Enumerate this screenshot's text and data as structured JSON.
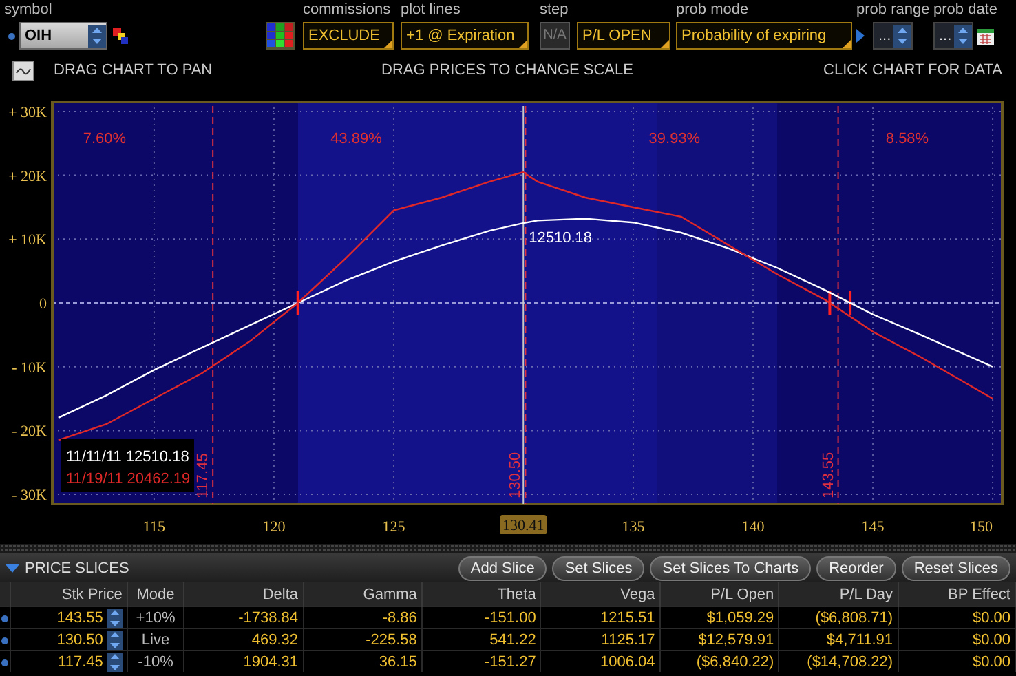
{
  "toolbar": {
    "symbol": {
      "label": "symbol",
      "value": "OIH"
    },
    "commissions": {
      "label": "commissions",
      "value": "EXCLUDE"
    },
    "plot_lines": {
      "label": "plot lines",
      "value": "+1 @ Expiration"
    },
    "step": {
      "label": "step",
      "value": "N/A",
      "disabled": true
    },
    "pl_mode": {
      "value": "P/L OPEN"
    },
    "prob_mode": {
      "label": "prob mode",
      "value": "Probability of expiring"
    },
    "prob_range": {
      "label": "prob range",
      "value": "..."
    },
    "prob_date": {
      "label": "prob date",
      "value": "..."
    }
  },
  "hints": [
    "DRAG CHART TO PAN",
    "DRAG PRICES TO CHANGE SCALE",
    "CLICK CHART FOR DATA"
  ],
  "chart": {
    "zones": [
      {
        "label": "7.60%"
      },
      {
        "label": "43.89%"
      },
      {
        "label": "39.93%"
      },
      {
        "label": "8.58%"
      }
    ],
    "current_value_label": "12510.18",
    "legend": [
      {
        "value": "12510.18"
      },
      {
        "value": "20462.19"
      }
    ],
    "chart_data": {
      "type": "line",
      "x": [
        111,
        113,
        115,
        117,
        119,
        121,
        123,
        125,
        127,
        129,
        130.4,
        131,
        133,
        135,
        137,
        139,
        141,
        143,
        145,
        147,
        150
      ],
      "series": [
        {
          "name": "11/11/11",
          "color": "#ffffff",
          "values": [
            -18000,
            -14500,
            -10500,
            -7000,
            -3500,
            0,
            3500,
            6500,
            9000,
            11300,
            12500,
            12900,
            13200,
            12600,
            11000,
            8500,
            5500,
            2000,
            -1800,
            -5000,
            -10000
          ]
        },
        {
          "name": "11/19/11",
          "color": "#e02828",
          "values": [
            -21500,
            -19000,
            -15000,
            -11000,
            -6000,
            0,
            7000,
            14500,
            16500,
            19000,
            20500,
            19000,
            16500,
            15000,
            13500,
            9000,
            4500,
            500,
            -4500,
            -8500,
            -15000
          ]
        }
      ],
      "xlim": [
        110.75,
        150.4
      ],
      "ylim": [
        -31500,
        31500
      ],
      "grid": true,
      "xticks": [
        115,
        120,
        125,
        135,
        140,
        145,
        150
      ],
      "yticks": [
        {
          "value": 30000,
          "label": "+ 30K"
        },
        {
          "value": 20000,
          "label": "+ 20K"
        },
        {
          "value": 10000,
          "label": "+ 10K"
        },
        {
          "value": 0,
          "label": "0"
        },
        {
          "value": -10000,
          "label": "- 10K"
        },
        {
          "value": -20000,
          "label": "- 20K"
        },
        {
          "value": -30000,
          "label": "- 30K"
        }
      ],
      "ref_lines": [
        {
          "axis": "x",
          "value": 117.45,
          "label": "117.45",
          "color": "#e03040"
        },
        {
          "axis": "x",
          "value": 130.5,
          "label": "130.50",
          "color": "#e03040"
        },
        {
          "axis": "x",
          "value": 143.55,
          "label": "143.55",
          "color": "#e03040"
        },
        {
          "axis": "x",
          "value": 130.41,
          "label": "130.41",
          "color": "#c8c8c8"
        },
        {
          "axis": "y",
          "value": 0,
          "color": "#9a9ad8"
        }
      ]
    }
  },
  "price_slices": {
    "title": "PRICE SLICES",
    "expanded": true,
    "buttons": [
      "Add Slice",
      "Set Slices",
      "Set Slices To Charts",
      "Reorder",
      "Reset Slices"
    ],
    "columns": [
      "Stk Price",
      "Mode",
      "Delta",
      "Gamma",
      "Theta",
      "Vega",
      "P/L Open",
      "P/L Day",
      "BP Effect"
    ],
    "rows": [
      {
        "cells": [
          "143.55",
          "+10%",
          "-1738.84",
          "-8.86",
          "-151.00",
          "1215.51",
          "$1,059.29",
          "($6,808.71)",
          "$0.00"
        ]
      },
      {
        "cells": [
          "130.50",
          "Live",
          "469.32",
          "-225.58",
          "541.22",
          "1125.17",
          "$12,579.91",
          "$4,711.91",
          "$0.00"
        ]
      },
      {
        "cells": [
          "117.45",
          "-10%",
          "1904.31",
          "36.15",
          "-151.27",
          "1006.04",
          "($6,840.22)",
          "($14,708.22)",
          "$0.00"
        ]
      }
    ]
  }
}
